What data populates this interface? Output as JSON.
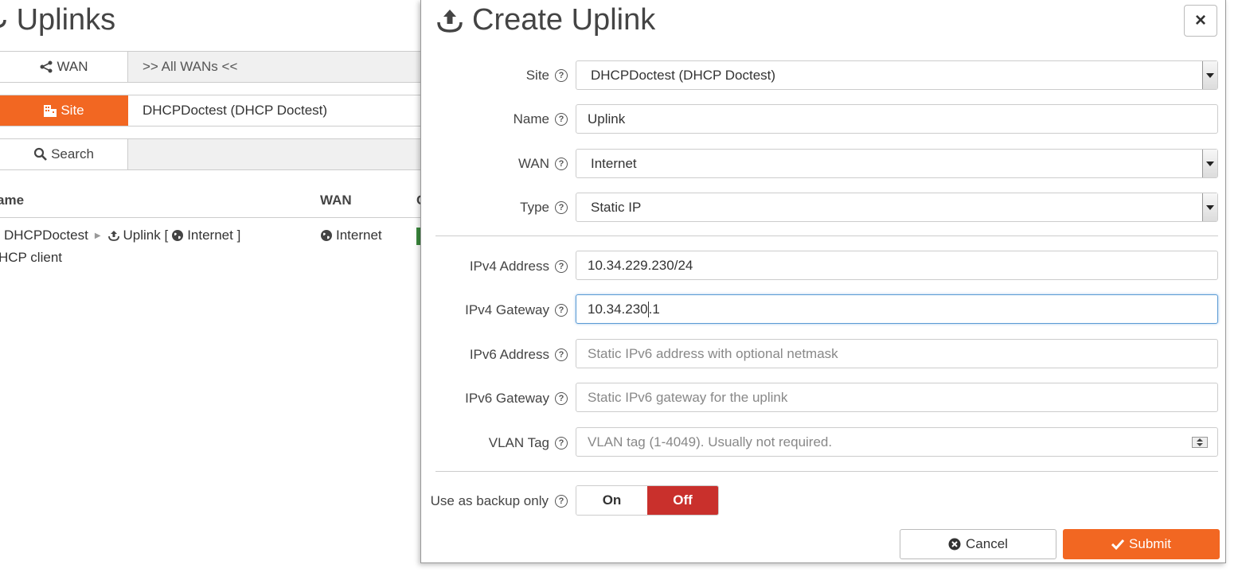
{
  "background": {
    "page_title": "Uplinks",
    "filters": {
      "wan": {
        "label": "WAN",
        "value": ">> All WANs <<"
      },
      "site": {
        "label": "Site",
        "value": "DHCPDoctest (DHCP Doctest)"
      },
      "search": {
        "label": "Search",
        "value": ""
      }
    },
    "table": {
      "columns": [
        "ame",
        "WAN",
        "C"
      ],
      "rows": [
        {
          "site": "DHCPDoctest",
          "uplink": "Uplink [",
          "wan_inline": "Internet ]",
          "sub": "HCP client",
          "wan": "Internet"
        }
      ]
    }
  },
  "modal": {
    "title": "Create Uplink",
    "close_label": "×",
    "fields": {
      "site": {
        "label": "Site",
        "value": "DHCPDoctest (DHCP Doctest)"
      },
      "name": {
        "label": "Name",
        "value": "Uplink"
      },
      "wan": {
        "label": "WAN",
        "value": "Internet"
      },
      "type": {
        "label": "Type",
        "value": "Static IP"
      },
      "ipv4_address": {
        "label": "IPv4 Address",
        "value": "10.34.229.230/24"
      },
      "ipv4_gateway": {
        "label": "IPv4 Gateway",
        "value_a": "10.34.230",
        "value_b": ".1"
      },
      "ipv6_address": {
        "label": "IPv6 Address",
        "placeholder": "Static IPv6 address with optional netmask"
      },
      "ipv6_gateway": {
        "label": "IPv6 Gateway",
        "placeholder": "Static IPv6 gateway for the uplink"
      },
      "vlan_tag": {
        "label": "VLAN Tag",
        "placeholder": "VLAN tag (1-4049). Usually not required."
      }
    },
    "backup": {
      "label": "Use as backup only",
      "on": "On",
      "off": "Off",
      "selected": "Off"
    },
    "help_glyph": "?",
    "buttons": {
      "cancel": "Cancel",
      "submit": "Submit"
    }
  },
  "colors": {
    "accent": "#f26722",
    "off_active": "#c9302c",
    "focus": "#5b9bd5"
  }
}
